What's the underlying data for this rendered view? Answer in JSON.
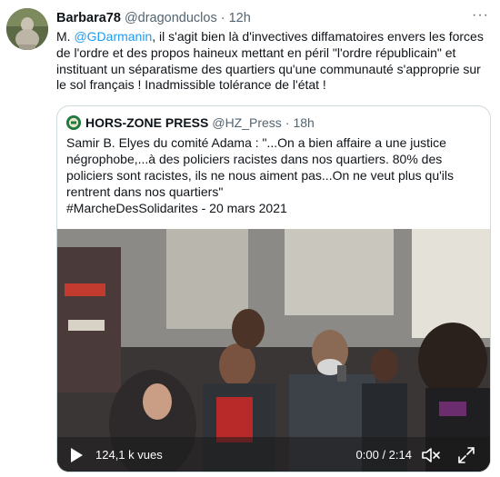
{
  "tweet": {
    "author_name": "Barbara78",
    "author_handle": "@dragonduclos",
    "separator": "·",
    "time": "12h",
    "more_label": "···",
    "text_prefix": "M. ",
    "mention": "@GDarmanin",
    "text_body": ", il s'agit bien là d'invectives diffamatoires envers les forces de l'ordre et des propos haineux mettant en péril \"l'ordre républicain\" et instituant un séparatisme des quartiers qu'une communauté s'approprie sur le sol français ! Inadmissible tolérance de l'état !"
  },
  "quoted": {
    "author_name": "HORS-ZONE PRESS",
    "author_handle": "@HZ_Press",
    "separator": "·",
    "time": "18h",
    "text_line1": "Samir B. Elyes du comité Adama : \"...On a bien affaire a une justice négrophobe,...à des policiers racistes dans nos quartiers. 80% des policiers sont racistes, ils ne nous aiment pas...On ne veut plus qu'ils rentrent dans nos quartiers\"",
    "text_line2": "#MarcheDesSolidarites - 20 mars 2021",
    "video": {
      "views": "124,1 k vues",
      "time": "0:00 / 2:14"
    }
  },
  "icons": {
    "avatar": "buddha-statue-avatar",
    "quoted_avatar": "hz-press-logo",
    "play": "play-icon",
    "mute": "volume-muted-icon",
    "fullscreen": "fullscreen-icon"
  }
}
